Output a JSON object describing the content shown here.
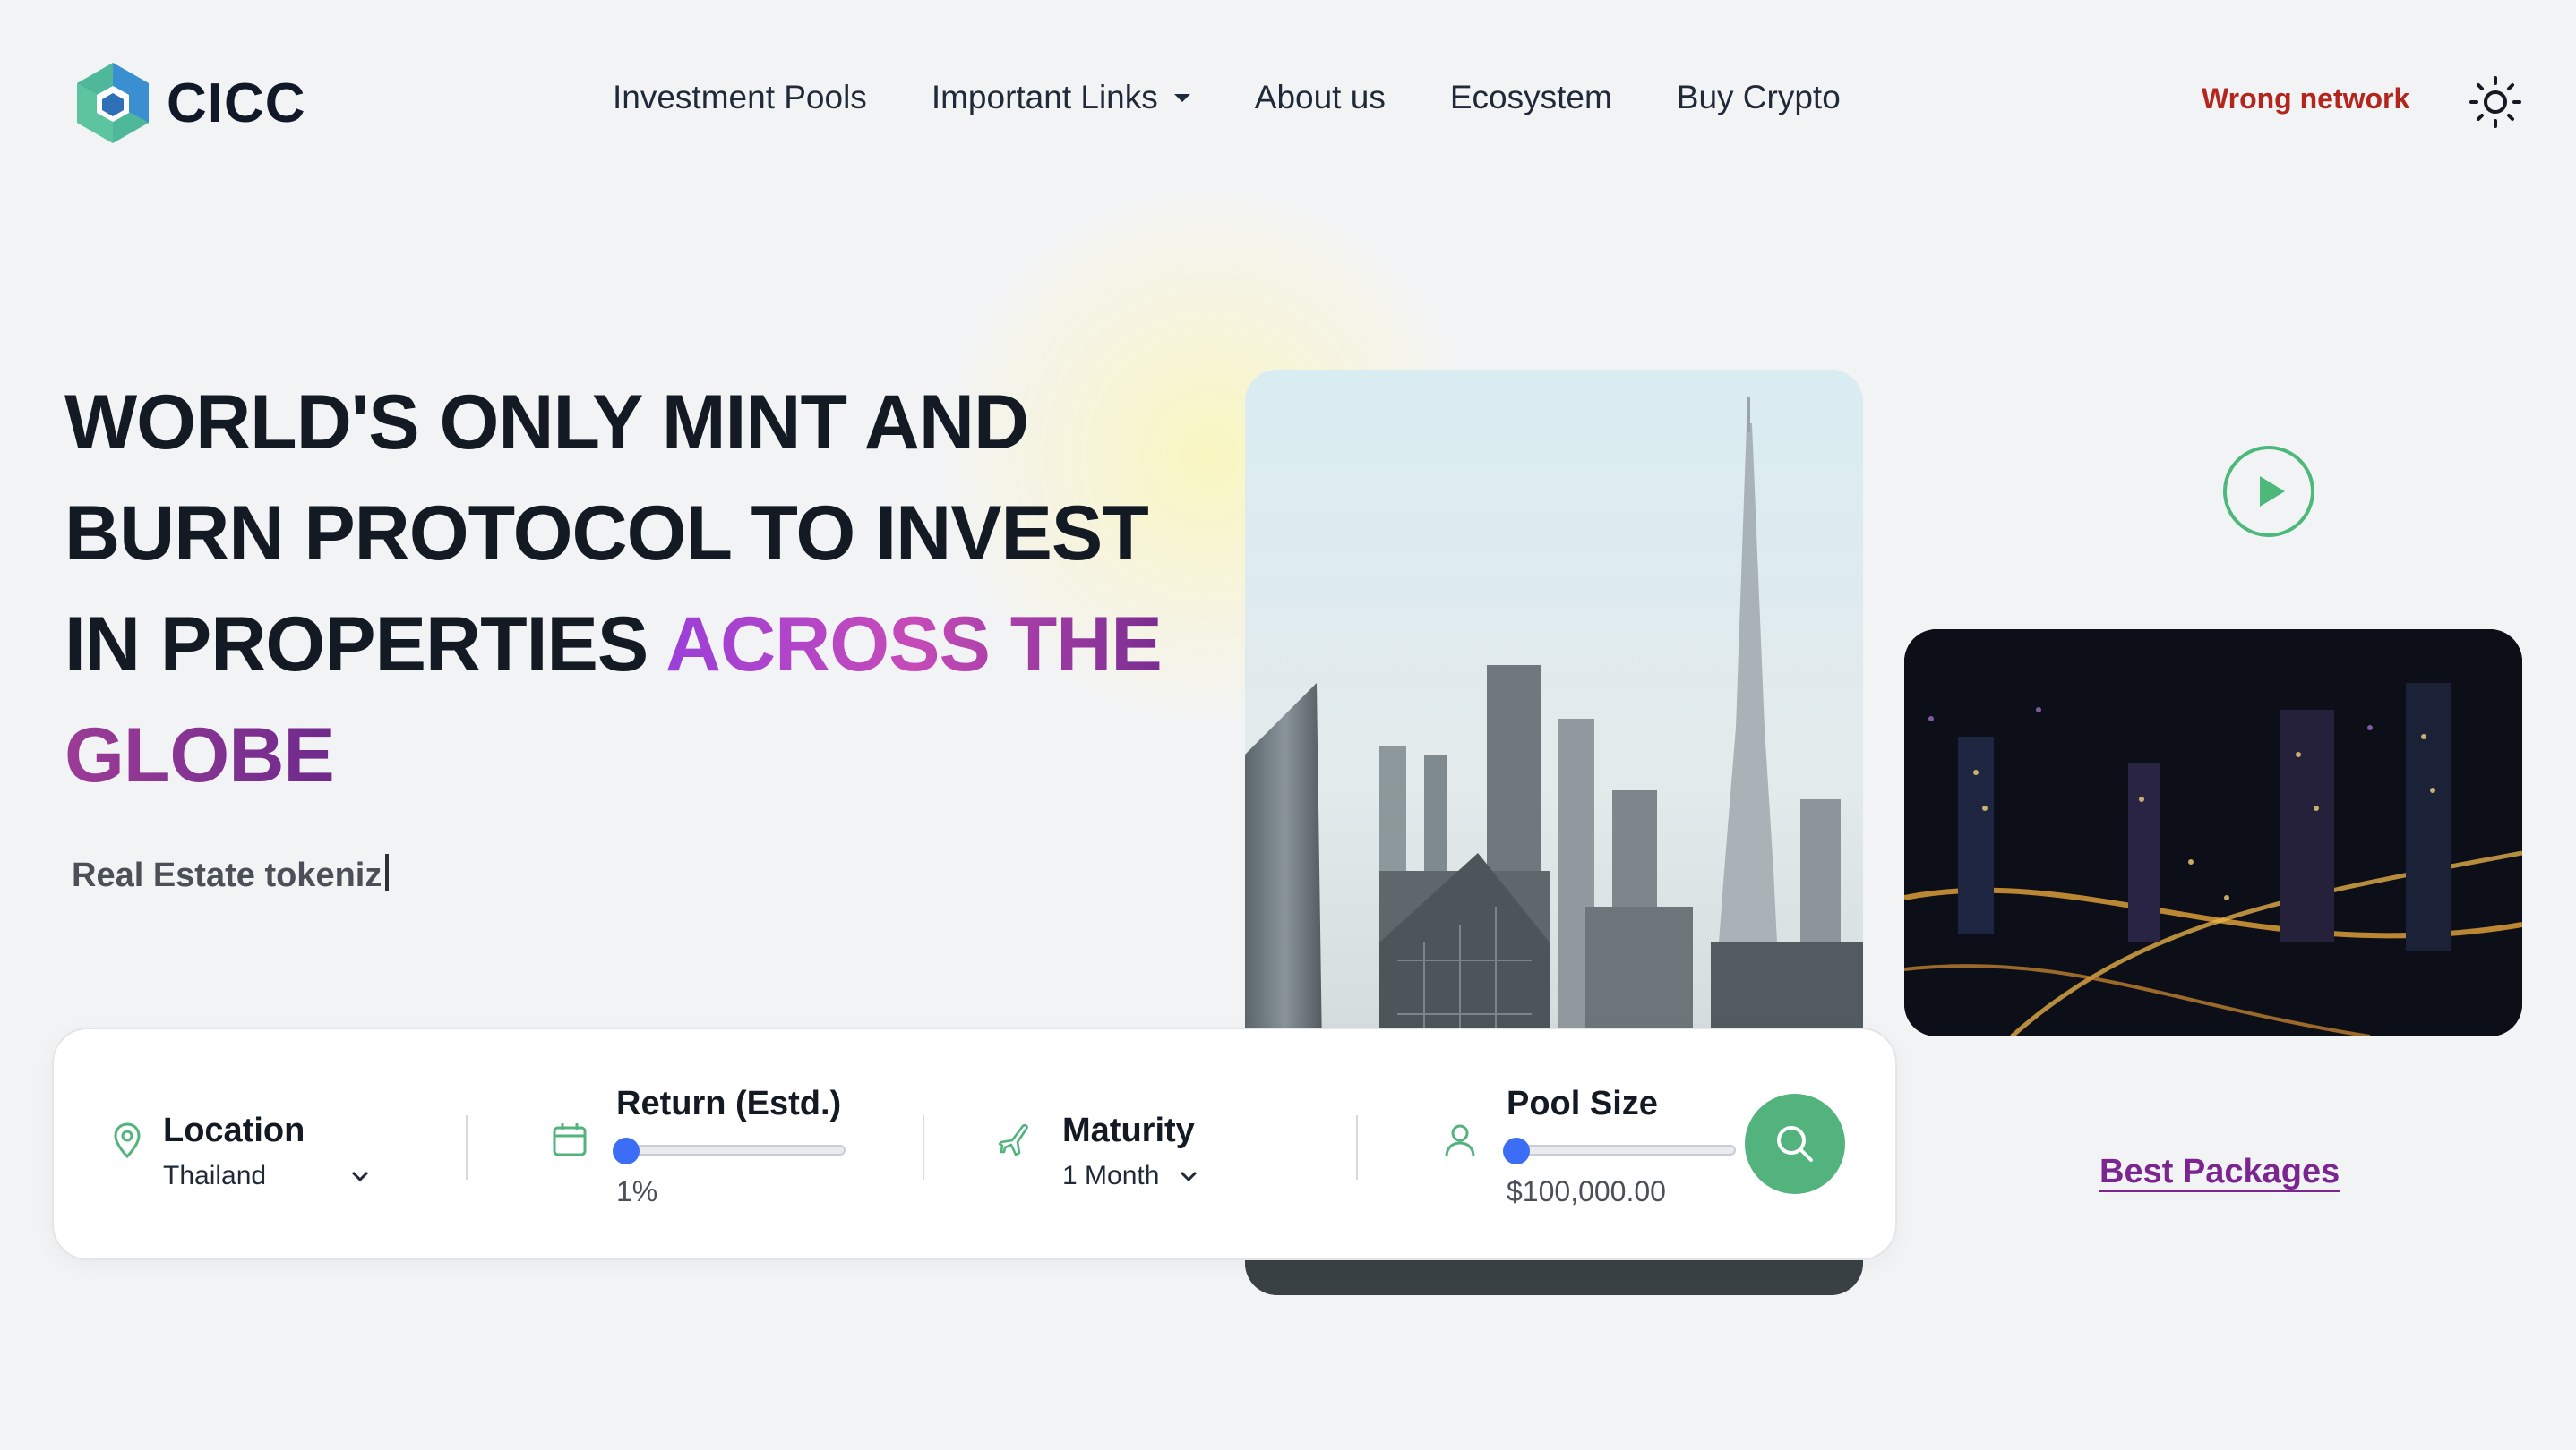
{
  "header": {
    "logo_text": "CICC",
    "nav": [
      {
        "label": "Investment Pools"
      },
      {
        "label": "Important Links",
        "has_dropdown": true
      },
      {
        "label": "About us"
      },
      {
        "label": "Ecosystem"
      },
      {
        "label": "Buy Crypto"
      }
    ],
    "network_status": "Wrong network",
    "theme_toggle_icon": "sun-icon"
  },
  "hero": {
    "headline_plain": "WORLD'S ONLY MINT AND BURN PROTOCOL TO INVEST IN PROPERTIES ",
    "headline_highlight_1": "ACROSS THE",
    "headline_highlight_2": "GLOBE",
    "typing_text": "Real Estate tokeniz",
    "play_icon": "play-icon",
    "best_packages_link": "Best Packages"
  },
  "search": {
    "location": {
      "label": "Location",
      "value": "Thailand",
      "icon": "map-pin-icon"
    },
    "return": {
      "label": "Return (Estd.)",
      "value_text": "1%",
      "slider_fraction": 0.0,
      "icon": "calendar-icon"
    },
    "maturity": {
      "label": "Maturity",
      "value": "1 Month",
      "icon": "airplane-icon"
    },
    "pool_size": {
      "label": "Pool Size",
      "value_text": "$100,000.00",
      "slider_fraction": 0.0,
      "icon": "user-icon"
    },
    "search_button_icon": "search-icon"
  },
  "colors": {
    "accent_green": "#52b47c",
    "warning_red": "#b3261e",
    "link_purple": "#7a2590",
    "slider_blue": "#3b6ef5"
  }
}
